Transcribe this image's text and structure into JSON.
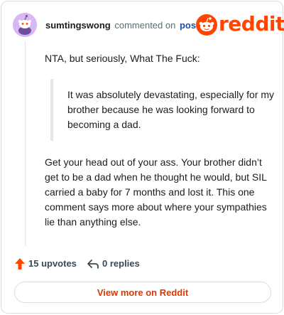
{
  "header": {
    "username": "sumtingswong",
    "action_text": "commented on",
    "post_link": "post",
    "brand": "reddit"
  },
  "comment": {
    "intro": "NTA, but seriously, What The Fuck:",
    "quote": "It was absolutely devastating, especially for my brother because he was looking forward to becoming a dad.",
    "body": "Get your head out of your ass. Your brother didn’t get to be a dad when he thought he would, but SIL carried a baby for 7 months and lost it. This one comment says more about where your sympathies lie than anything else."
  },
  "actions": {
    "upvotes": "15 upvotes",
    "replies": "0 replies"
  },
  "footer": {
    "view_more": "View more on Reddit"
  },
  "colors": {
    "brand": "#ff4500",
    "link": "#1a4fa8",
    "avatar_bg": "#d8b7f2"
  },
  "icons": {
    "avatar": "snoo-avatar-icon",
    "logo": "reddit-logo-icon",
    "upvote": "upvote-arrow-icon",
    "reply": "reply-arrow-icon"
  }
}
